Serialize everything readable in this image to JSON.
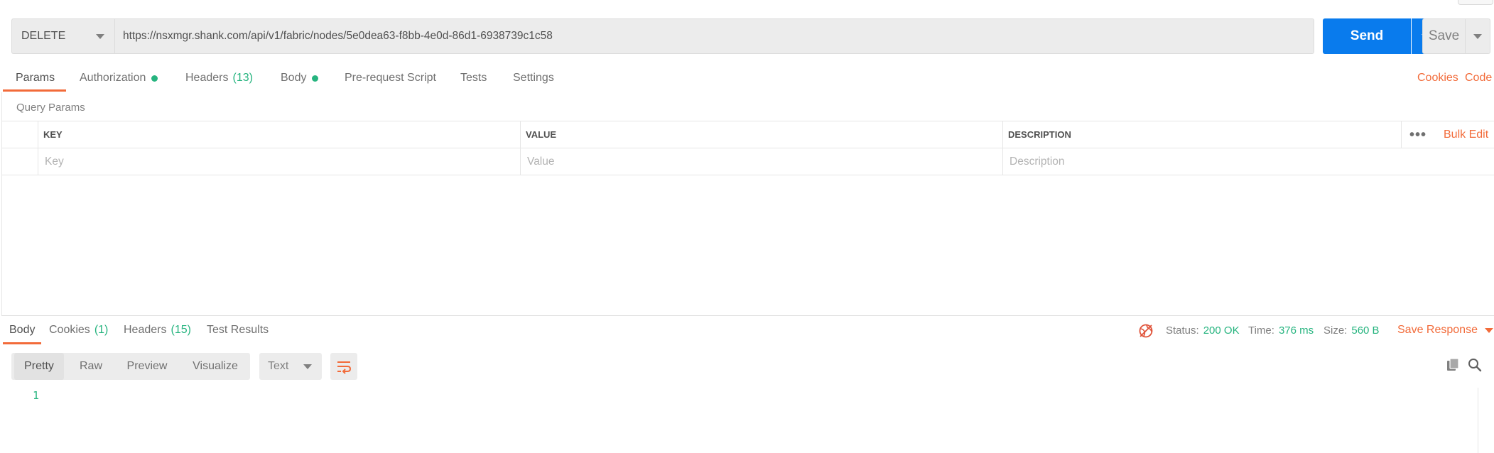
{
  "request": {
    "method": "DELETE",
    "url": "https://nsxmgr.shank.com/api/v1/fabric/nodes/5e0dea63-f8bb-4e0d-86d1-6938739c1c58",
    "send_label": "Send",
    "save_label": "Save"
  },
  "request_tabs": {
    "params": "Params",
    "authorization": "Authorization",
    "headers": "Headers",
    "headers_count": "(13)",
    "body": "Body",
    "pre_request": "Pre-request Script",
    "tests": "Tests",
    "settings": "Settings",
    "cookies": "Cookies",
    "code": "Code"
  },
  "params": {
    "section_title": "Query Params",
    "columns": [
      "KEY",
      "VALUE",
      "DESCRIPTION"
    ],
    "placeholders": [
      "Key",
      "Value",
      "Description"
    ],
    "bulk_edit": "Bulk Edit",
    "more": "•••"
  },
  "response_tabs": {
    "body": "Body",
    "cookies": "Cookies",
    "cookies_count": "(1)",
    "headers": "Headers",
    "headers_count": "(15)",
    "test_results": "Test Results"
  },
  "status": {
    "status_label": "Status:",
    "status_value": "200 OK",
    "time_label": "Time:",
    "time_value": "376 ms",
    "size_label": "Size:",
    "size_value": "560 B",
    "save_response": "Save Response"
  },
  "view_modes": [
    "Pretty",
    "Raw",
    "Preview",
    "Visualize"
  ],
  "format": "Text",
  "editor": {
    "line_numbers": [
      "1"
    ]
  },
  "colors": {
    "accent": "#f26b3a",
    "send": "#097bed",
    "success": "#26b47f"
  }
}
